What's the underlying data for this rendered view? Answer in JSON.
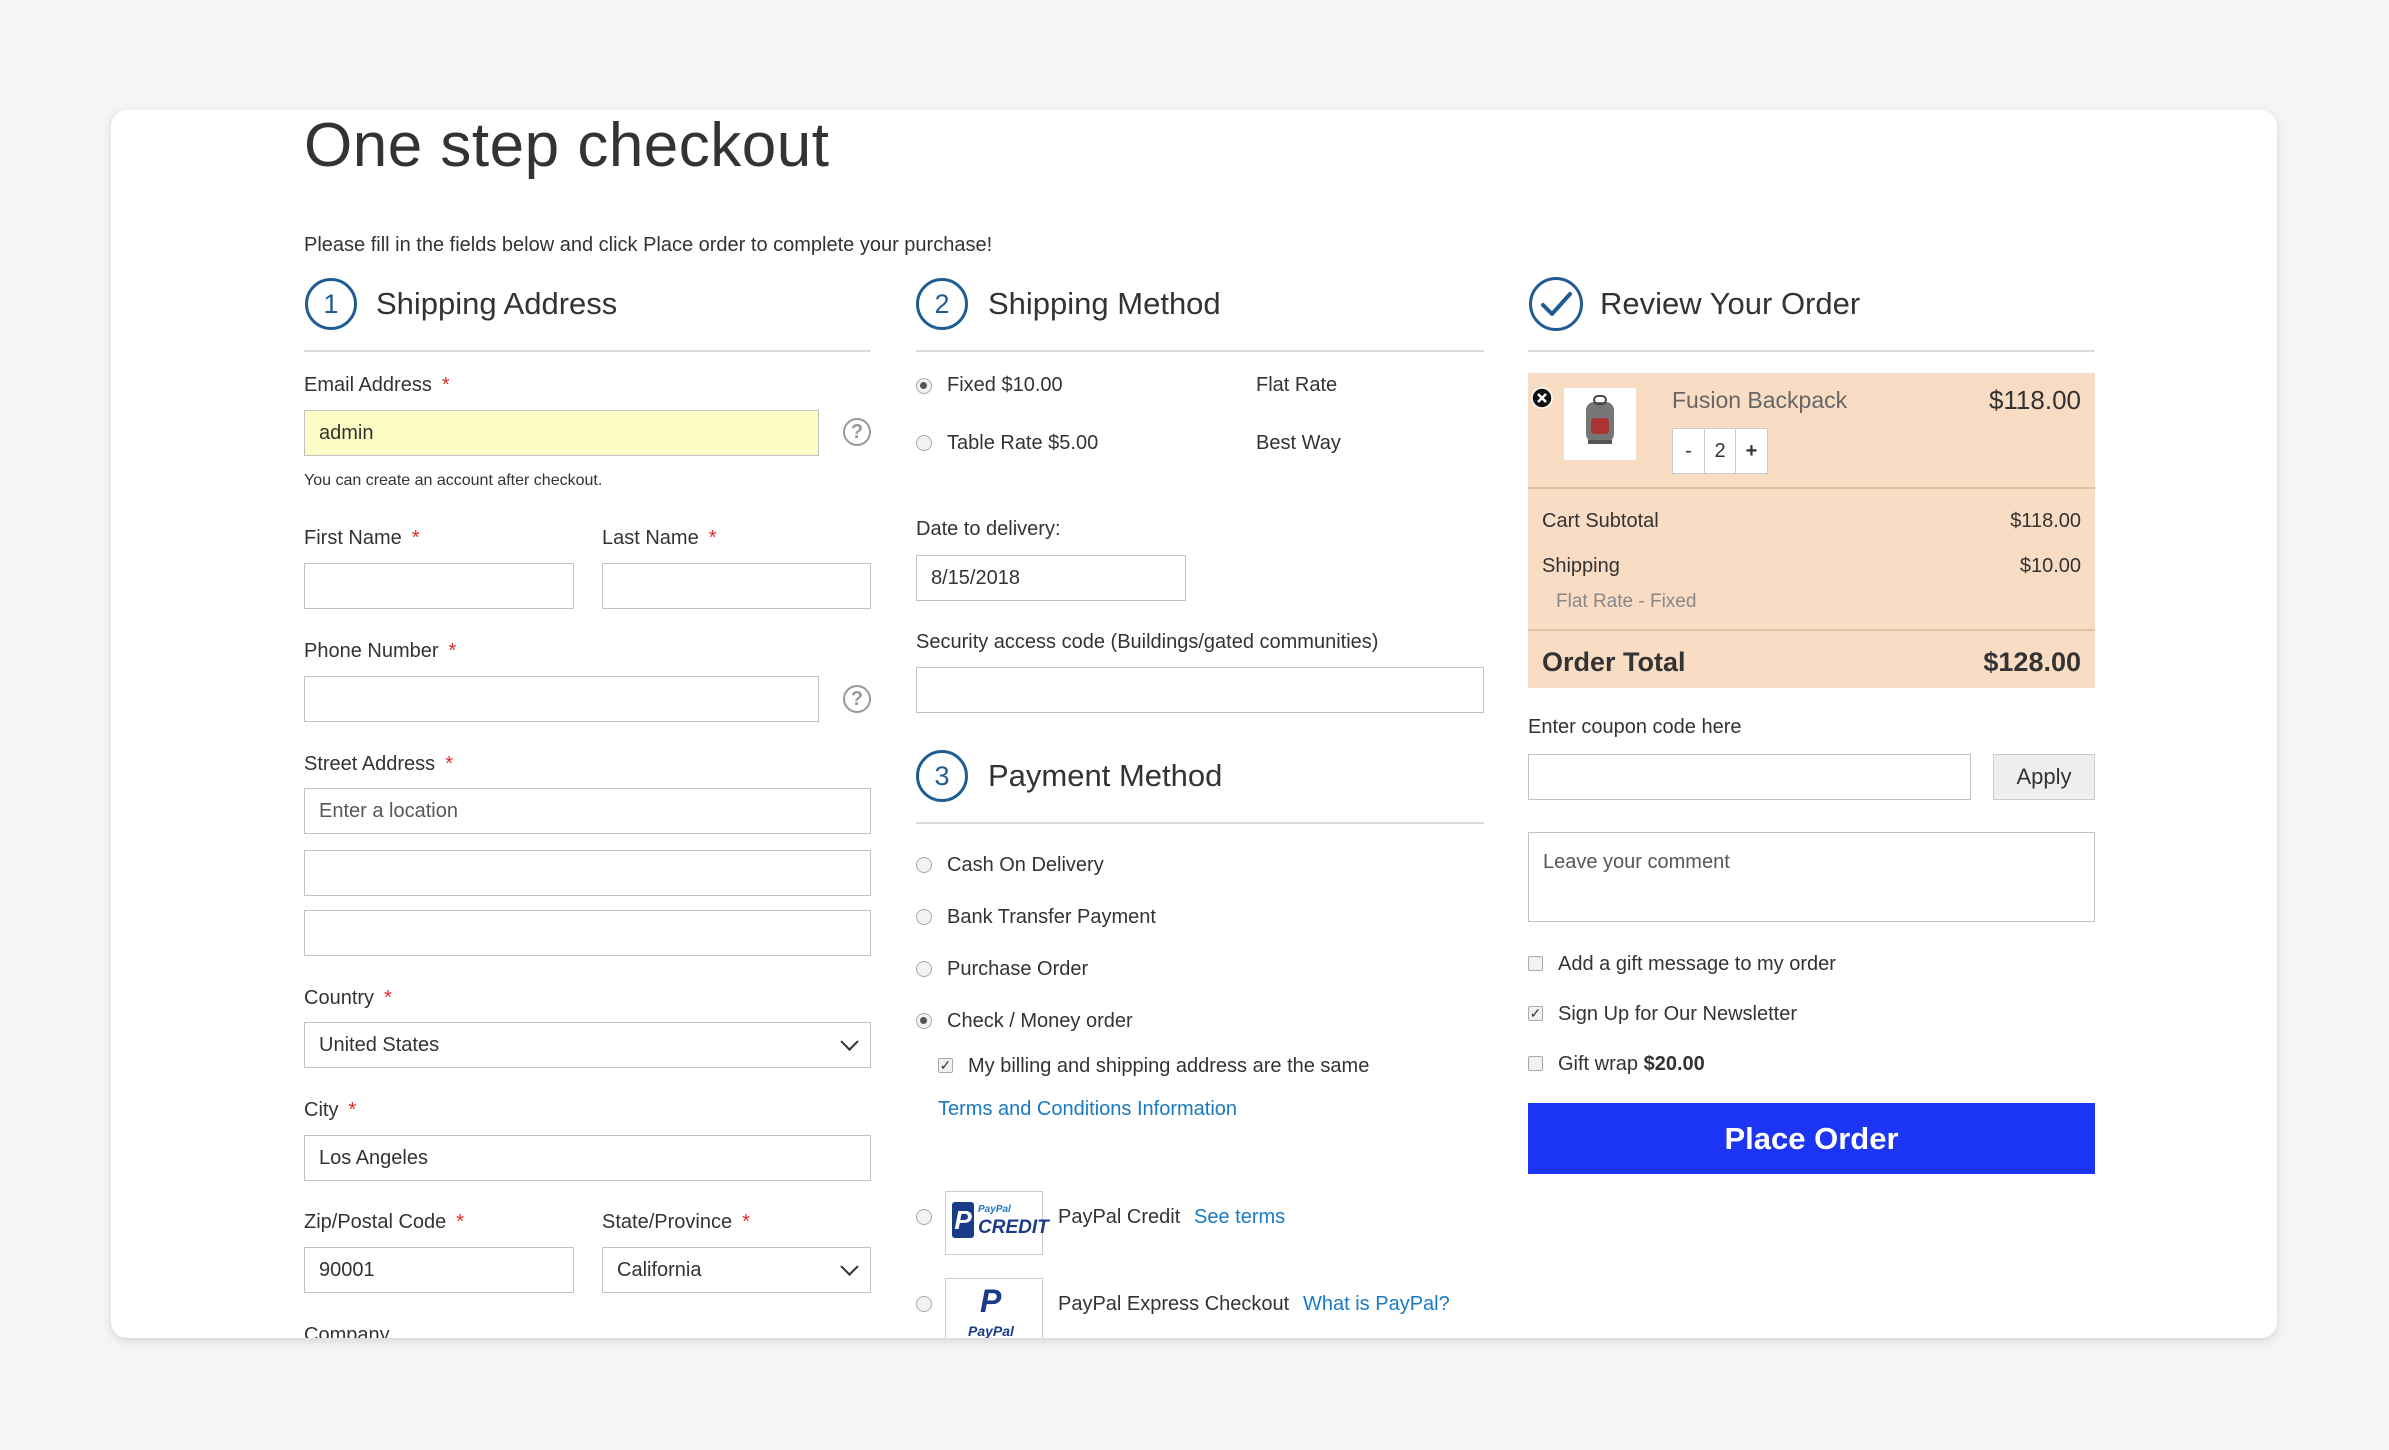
{
  "title": "One step checkout",
  "intro": "Please fill in the fields below and click Place order to complete your purchase!",
  "colors": {
    "accent": "#1f5c94",
    "place_order": "#1c35f5",
    "summary_bg": "#f9dcc4",
    "required": "#e02b27",
    "link": "#1979c3"
  },
  "shipping_address": {
    "step": "1",
    "title": "Shipping Address",
    "email_label": "Email Address",
    "email_value": "admin",
    "email_note": "You can create an account after checkout.",
    "first_name_label": "First Name",
    "last_name_label": "Last Name",
    "phone_label": "Phone Number",
    "street_label": "Street Address",
    "street_placeholder": "Enter a location",
    "country_label": "Country",
    "country_value": "United States",
    "city_label": "City",
    "city_value": "Los Angeles",
    "zip_label": "Zip/Postal Code",
    "zip_value": "90001",
    "state_label": "State/Province",
    "state_value": "California",
    "company_label": "Company",
    "required_mark": "*",
    "help_icon": "?"
  },
  "shipping_method": {
    "step": "2",
    "title": "Shipping Method",
    "options": [
      {
        "label": "Fixed $10.00",
        "carrier": "Flat Rate",
        "selected": true
      },
      {
        "label": "Table Rate $5.00",
        "carrier": "Best Way",
        "selected": false
      }
    ],
    "date_label": "Date to delivery:",
    "date_value": "8/15/2018",
    "security_label": "Security access code (Buildings/gated communities)"
  },
  "payment_method": {
    "step": "3",
    "title": "Payment Method",
    "options": [
      {
        "label": "Cash On Delivery",
        "selected": false
      },
      {
        "label": "Bank Transfer Payment",
        "selected": false
      },
      {
        "label": "Purchase Order",
        "selected": false
      },
      {
        "label": "Check / Money order",
        "selected": true
      }
    ],
    "same_address_label": "My billing and shipping address are the same",
    "terms_link": "Terms and Conditions Information",
    "paypal_credit_label": "PayPal Credit",
    "paypal_credit_link": "See terms",
    "paypal_credit_logo_small": "PayPal",
    "paypal_credit_logo_big": "CREDIT",
    "paypal_express_label": "PayPal Express Checkout",
    "paypal_express_link": "What is PayPal?",
    "paypal_logo_text": "PayPal"
  },
  "review": {
    "title": "Review Your Order",
    "item_name": "Fusion Backpack",
    "item_price": "$118.00",
    "qty_minus": "-",
    "qty_value": "2",
    "qty_plus": "+",
    "subtotal_label": "Cart Subtotal",
    "subtotal_value": "$118.00",
    "shipping_label": "Shipping",
    "shipping_value": "$10.00",
    "shipping_method": "Flat Rate - Fixed",
    "total_label": "Order Total",
    "total_value": "$128.00",
    "coupon_label": "Enter coupon code here",
    "apply_label": "Apply",
    "comment_placeholder": "Leave your comment",
    "gift_message_label": "Add a gift message to my order",
    "newsletter_label": "Sign Up for Our Newsletter",
    "gift_wrap_label": "Gift wrap",
    "gift_wrap_price": "$20.00",
    "place_order_label": "Place Order"
  }
}
